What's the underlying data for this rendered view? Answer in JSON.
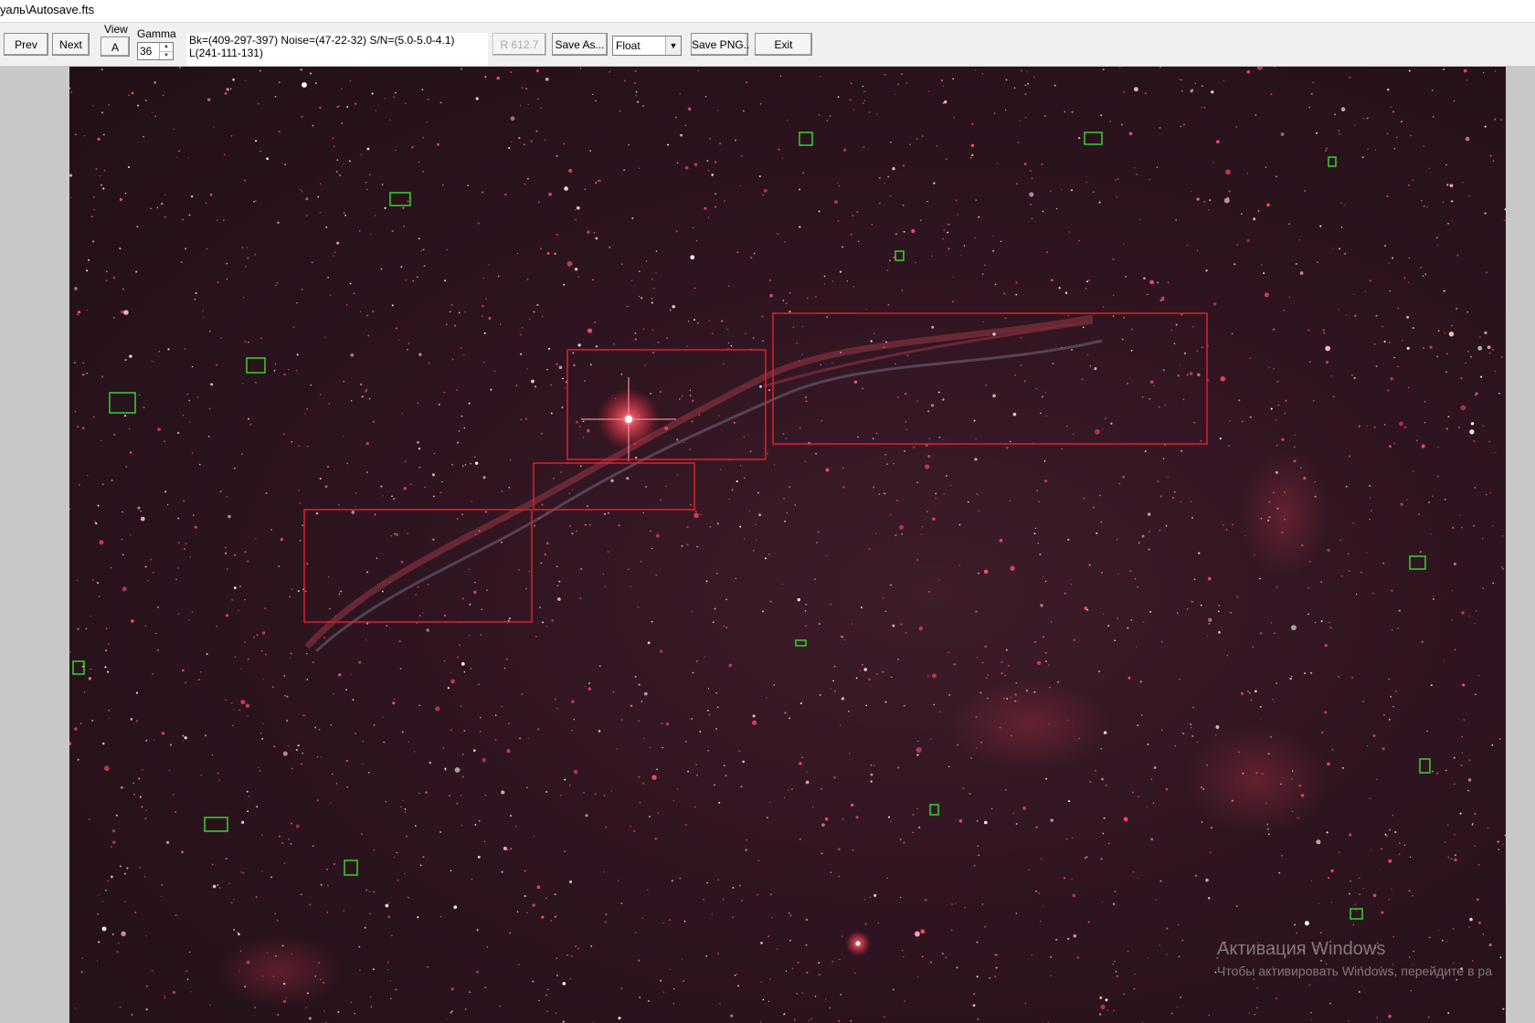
{
  "window": {
    "title": "уаль\\Autosave.fts"
  },
  "toolbar": {
    "prev_label": "Prev",
    "next_label": "Next",
    "view_label": "View",
    "view_button": "A",
    "gamma_label": "Gamma",
    "gamma_value": "36",
    "stats_line1": "Bk=(409-297-397) Noise=(47-22-32) S/N=(5.0-5.0-4.1)",
    "stats_line2": "L(241-111-131)",
    "r_value_label": "R 612.7",
    "save_as_label": "Save As...",
    "format_selected": "Float",
    "save_png_label": "Save PNG..",
    "exit_label": "Exit"
  },
  "colors": {
    "red_roi": "#e0202a",
    "green_roi": "#39d12e"
  },
  "watermark": {
    "line1": "Активация Windows",
    "line2": "Чтобы активировать Windows, перейдите в ра"
  }
}
